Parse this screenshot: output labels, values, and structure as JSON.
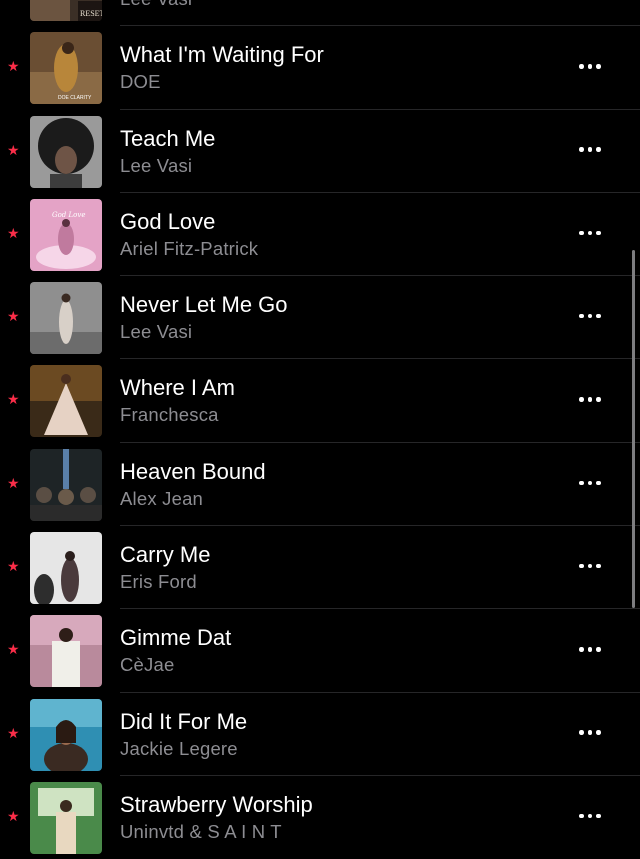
{
  "songs": [
    {
      "title": "",
      "artist": "Lee Vasi",
      "art_text": "RESET",
      "favorite": true
    },
    {
      "title": "What I'm Waiting For",
      "artist": "DOE",
      "art_text": "DOE CLARITY",
      "favorite": true
    },
    {
      "title": "Teach Me",
      "artist": "Lee Vasi",
      "art_text": "",
      "favorite": true
    },
    {
      "title": "God Love",
      "artist": "Ariel Fitz-Patrick",
      "art_text": "God Love",
      "favorite": true
    },
    {
      "title": "Never Let Me Go",
      "artist": "Lee Vasi",
      "art_text": "",
      "favorite": true
    },
    {
      "title": "Where I Am",
      "artist": "Franchesca",
      "art_text": "",
      "favorite": true
    },
    {
      "title": "Heaven Bound",
      "artist": "Alex Jean",
      "art_text": "",
      "favorite": true
    },
    {
      "title": "Carry Me",
      "artist": "Eris Ford",
      "art_text": "",
      "favorite": true
    },
    {
      "title": "Gimme Dat",
      "artist": "CèJae",
      "art_text": "",
      "favorite": true
    },
    {
      "title": "Did It For Me",
      "artist": "Jackie Legere",
      "art_text": "",
      "favorite": true
    },
    {
      "title": "Strawberry Worship",
      "artist": "Uninvtd & S A I N T",
      "art_text": "",
      "favorite": true
    }
  ],
  "favorite_glyph": "★",
  "more_icon": "ellipsis-icon",
  "colors": {
    "background": "#000000",
    "title": "#ffffff",
    "artist": "#8d8d92",
    "star": "#fa2d48",
    "separator": "#262628"
  }
}
